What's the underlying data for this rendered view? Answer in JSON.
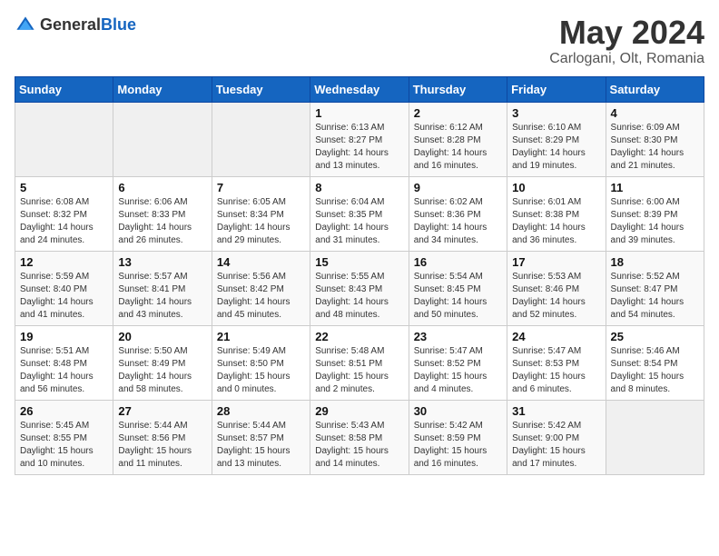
{
  "header": {
    "logo_general": "General",
    "logo_blue": "Blue",
    "month": "May 2024",
    "location": "Carlogani, Olt, Romania"
  },
  "weekdays": [
    "Sunday",
    "Monday",
    "Tuesday",
    "Wednesday",
    "Thursday",
    "Friday",
    "Saturday"
  ],
  "weeks": [
    [
      {
        "day": "",
        "sunrise": "",
        "sunset": "",
        "daylight": ""
      },
      {
        "day": "",
        "sunrise": "",
        "sunset": "",
        "daylight": ""
      },
      {
        "day": "",
        "sunrise": "",
        "sunset": "",
        "daylight": ""
      },
      {
        "day": "1",
        "sunrise": "Sunrise: 6:13 AM",
        "sunset": "Sunset: 8:27 PM",
        "daylight": "Daylight: 14 hours and 13 minutes."
      },
      {
        "day": "2",
        "sunrise": "Sunrise: 6:12 AM",
        "sunset": "Sunset: 8:28 PM",
        "daylight": "Daylight: 14 hours and 16 minutes."
      },
      {
        "day": "3",
        "sunrise": "Sunrise: 6:10 AM",
        "sunset": "Sunset: 8:29 PM",
        "daylight": "Daylight: 14 hours and 19 minutes."
      },
      {
        "day": "4",
        "sunrise": "Sunrise: 6:09 AM",
        "sunset": "Sunset: 8:30 PM",
        "daylight": "Daylight: 14 hours and 21 minutes."
      }
    ],
    [
      {
        "day": "5",
        "sunrise": "Sunrise: 6:08 AM",
        "sunset": "Sunset: 8:32 PM",
        "daylight": "Daylight: 14 hours and 24 minutes."
      },
      {
        "day": "6",
        "sunrise": "Sunrise: 6:06 AM",
        "sunset": "Sunset: 8:33 PM",
        "daylight": "Daylight: 14 hours and 26 minutes."
      },
      {
        "day": "7",
        "sunrise": "Sunrise: 6:05 AM",
        "sunset": "Sunset: 8:34 PM",
        "daylight": "Daylight: 14 hours and 29 minutes."
      },
      {
        "day": "8",
        "sunrise": "Sunrise: 6:04 AM",
        "sunset": "Sunset: 8:35 PM",
        "daylight": "Daylight: 14 hours and 31 minutes."
      },
      {
        "day": "9",
        "sunrise": "Sunrise: 6:02 AM",
        "sunset": "Sunset: 8:36 PM",
        "daylight": "Daylight: 14 hours and 34 minutes."
      },
      {
        "day": "10",
        "sunrise": "Sunrise: 6:01 AM",
        "sunset": "Sunset: 8:38 PM",
        "daylight": "Daylight: 14 hours and 36 minutes."
      },
      {
        "day": "11",
        "sunrise": "Sunrise: 6:00 AM",
        "sunset": "Sunset: 8:39 PM",
        "daylight": "Daylight: 14 hours and 39 minutes."
      }
    ],
    [
      {
        "day": "12",
        "sunrise": "Sunrise: 5:59 AM",
        "sunset": "Sunset: 8:40 PM",
        "daylight": "Daylight: 14 hours and 41 minutes."
      },
      {
        "day": "13",
        "sunrise": "Sunrise: 5:57 AM",
        "sunset": "Sunset: 8:41 PM",
        "daylight": "Daylight: 14 hours and 43 minutes."
      },
      {
        "day": "14",
        "sunrise": "Sunrise: 5:56 AM",
        "sunset": "Sunset: 8:42 PM",
        "daylight": "Daylight: 14 hours and 45 minutes."
      },
      {
        "day": "15",
        "sunrise": "Sunrise: 5:55 AM",
        "sunset": "Sunset: 8:43 PM",
        "daylight": "Daylight: 14 hours and 48 minutes."
      },
      {
        "day": "16",
        "sunrise": "Sunrise: 5:54 AM",
        "sunset": "Sunset: 8:45 PM",
        "daylight": "Daylight: 14 hours and 50 minutes."
      },
      {
        "day": "17",
        "sunrise": "Sunrise: 5:53 AM",
        "sunset": "Sunset: 8:46 PM",
        "daylight": "Daylight: 14 hours and 52 minutes."
      },
      {
        "day": "18",
        "sunrise": "Sunrise: 5:52 AM",
        "sunset": "Sunset: 8:47 PM",
        "daylight": "Daylight: 14 hours and 54 minutes."
      }
    ],
    [
      {
        "day": "19",
        "sunrise": "Sunrise: 5:51 AM",
        "sunset": "Sunset: 8:48 PM",
        "daylight": "Daylight: 14 hours and 56 minutes."
      },
      {
        "day": "20",
        "sunrise": "Sunrise: 5:50 AM",
        "sunset": "Sunset: 8:49 PM",
        "daylight": "Daylight: 14 hours and 58 minutes."
      },
      {
        "day": "21",
        "sunrise": "Sunrise: 5:49 AM",
        "sunset": "Sunset: 8:50 PM",
        "daylight": "Daylight: 15 hours and 0 minutes."
      },
      {
        "day": "22",
        "sunrise": "Sunrise: 5:48 AM",
        "sunset": "Sunset: 8:51 PM",
        "daylight": "Daylight: 15 hours and 2 minutes."
      },
      {
        "day": "23",
        "sunrise": "Sunrise: 5:47 AM",
        "sunset": "Sunset: 8:52 PM",
        "daylight": "Daylight: 15 hours and 4 minutes."
      },
      {
        "day": "24",
        "sunrise": "Sunrise: 5:47 AM",
        "sunset": "Sunset: 8:53 PM",
        "daylight": "Daylight: 15 hours and 6 minutes."
      },
      {
        "day": "25",
        "sunrise": "Sunrise: 5:46 AM",
        "sunset": "Sunset: 8:54 PM",
        "daylight": "Daylight: 15 hours and 8 minutes."
      }
    ],
    [
      {
        "day": "26",
        "sunrise": "Sunrise: 5:45 AM",
        "sunset": "Sunset: 8:55 PM",
        "daylight": "Daylight: 15 hours and 10 minutes."
      },
      {
        "day": "27",
        "sunrise": "Sunrise: 5:44 AM",
        "sunset": "Sunset: 8:56 PM",
        "daylight": "Daylight: 15 hours and 11 minutes."
      },
      {
        "day": "28",
        "sunrise": "Sunrise: 5:44 AM",
        "sunset": "Sunset: 8:57 PM",
        "daylight": "Daylight: 15 hours and 13 minutes."
      },
      {
        "day": "29",
        "sunrise": "Sunrise: 5:43 AM",
        "sunset": "Sunset: 8:58 PM",
        "daylight": "Daylight: 15 hours and 14 minutes."
      },
      {
        "day": "30",
        "sunrise": "Sunrise: 5:42 AM",
        "sunset": "Sunset: 8:59 PM",
        "daylight": "Daylight: 15 hours and 16 minutes."
      },
      {
        "day": "31",
        "sunrise": "Sunrise: 5:42 AM",
        "sunset": "Sunset: 9:00 PM",
        "daylight": "Daylight: 15 hours and 17 minutes."
      },
      {
        "day": "",
        "sunrise": "",
        "sunset": "",
        "daylight": ""
      }
    ]
  ]
}
